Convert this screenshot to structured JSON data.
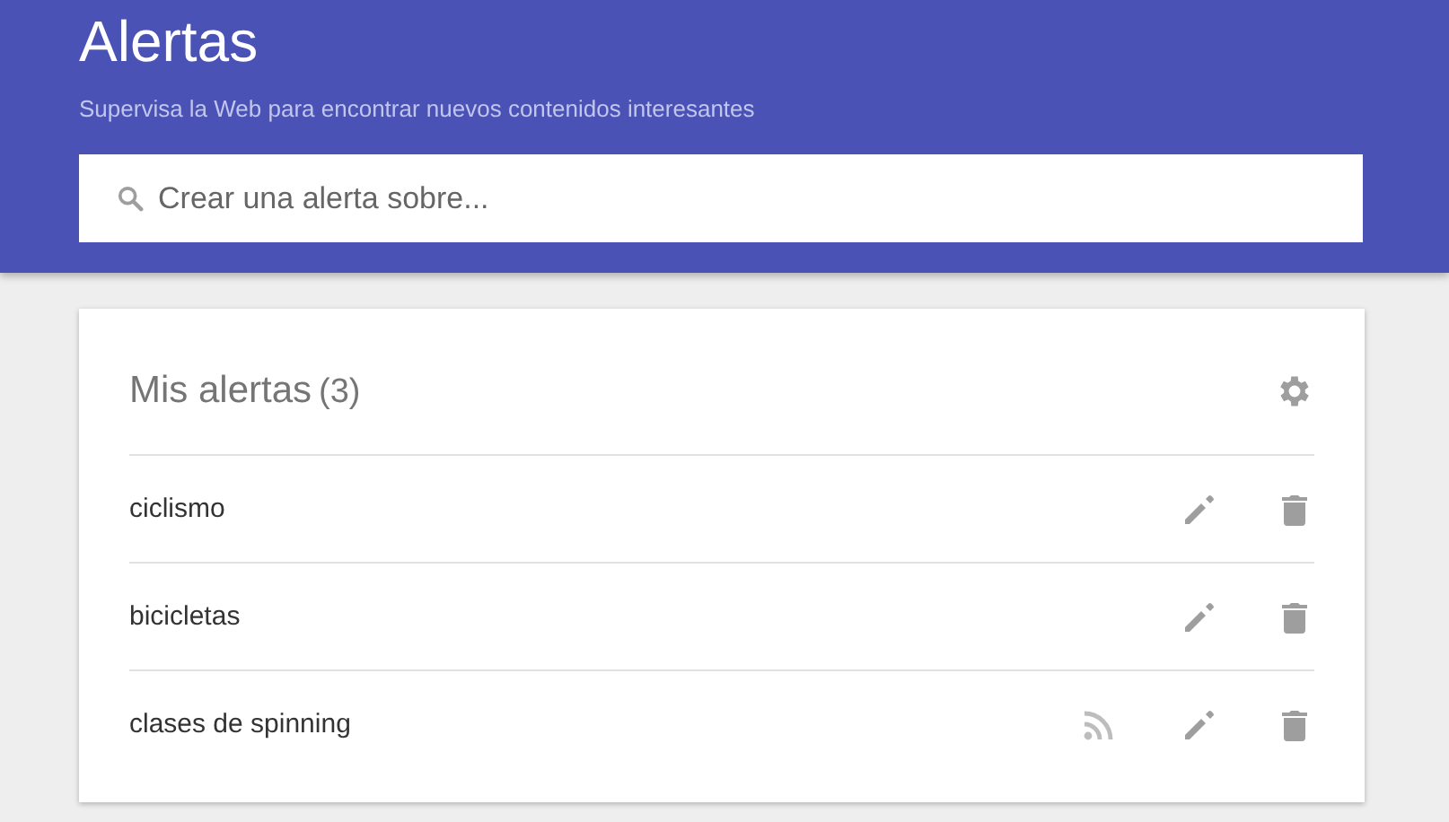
{
  "header": {
    "title": "Alertas",
    "subtitle": "Supervisa la Web para encontrar nuevos contenidos interesantes"
  },
  "search": {
    "placeholder": "Crear una alerta sobre..."
  },
  "alerts_card": {
    "title": "Mis alertas",
    "count": "(3)",
    "alerts": [
      {
        "name": "ciclismo",
        "rss": false
      },
      {
        "name": "bicicletas",
        "rss": false
      },
      {
        "name": "clases de spinning",
        "rss": true
      }
    ]
  }
}
